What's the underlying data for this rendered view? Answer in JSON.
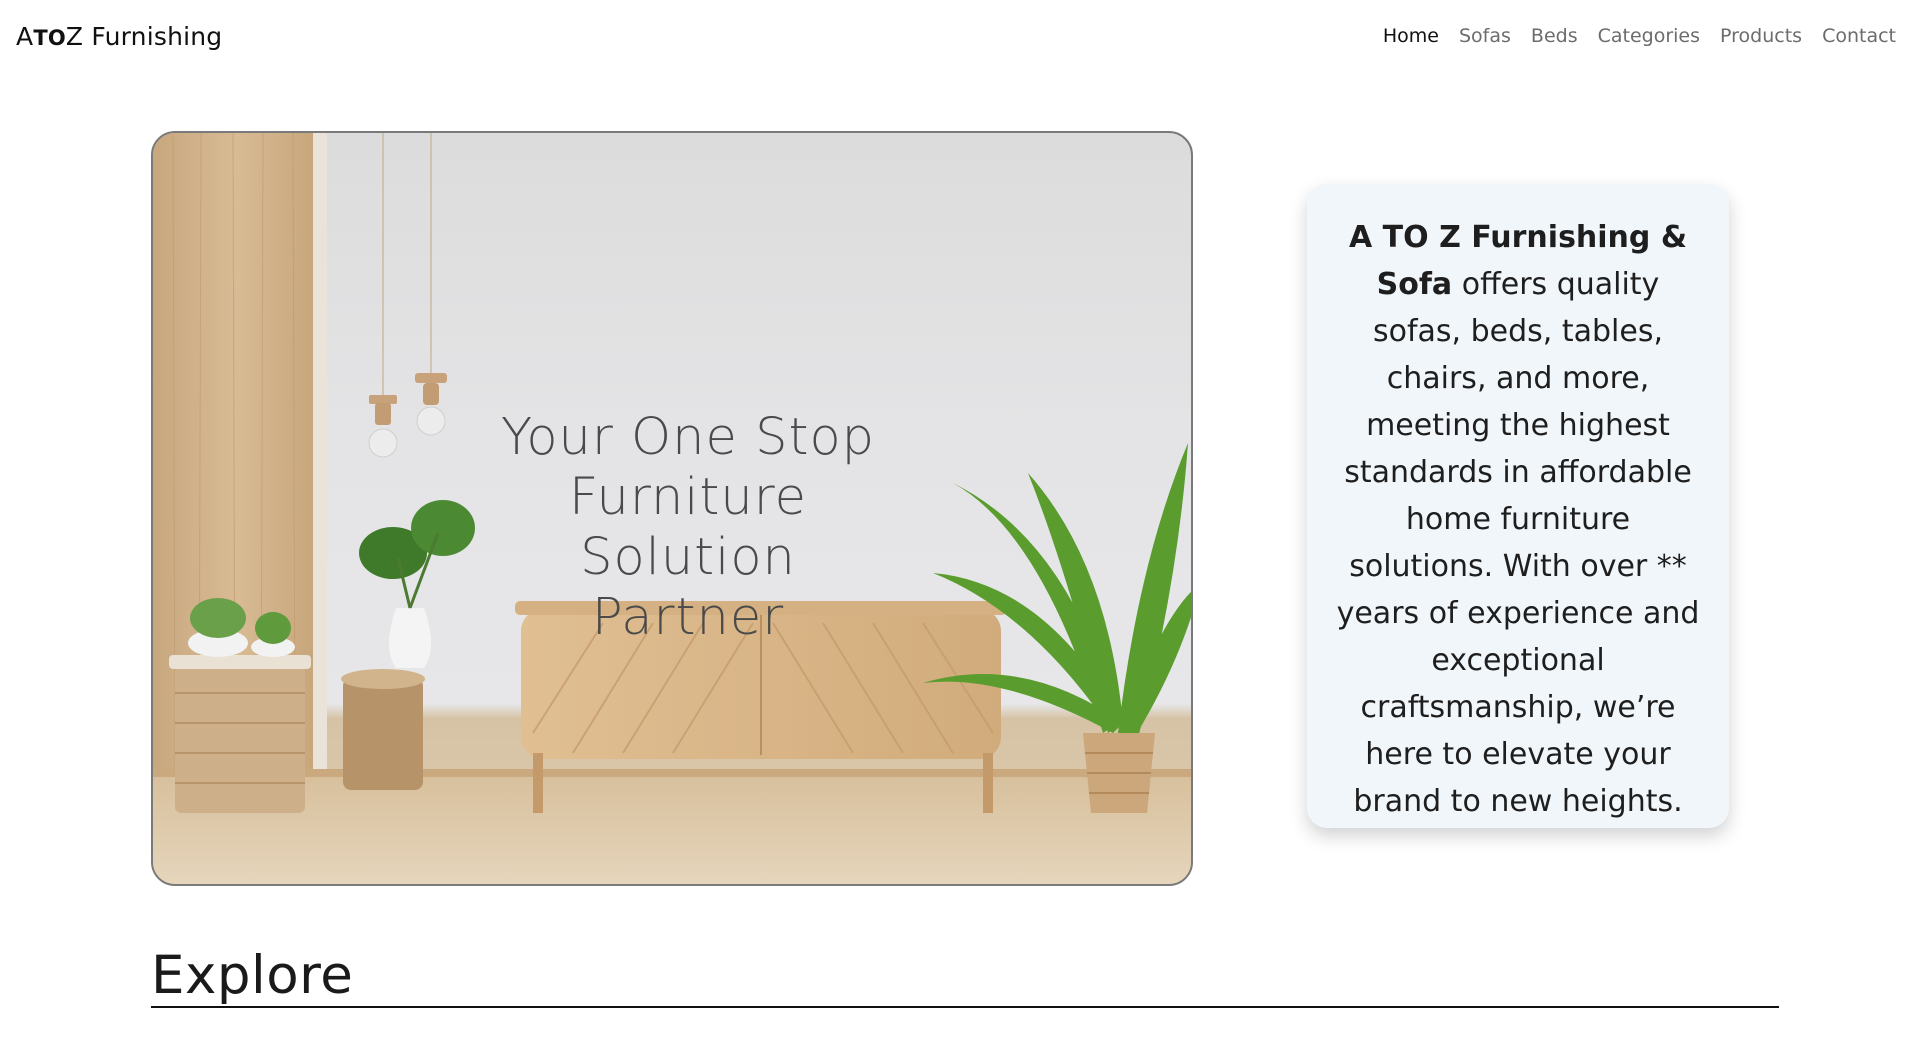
{
  "navbar": {
    "brand": {
      "part1": "A",
      "part2": "TO",
      "part3": "Z Furnishing"
    },
    "links": [
      "Home",
      "Sofas",
      "Beds",
      "Categories",
      "Products",
      "Contact"
    ],
    "active": "Home"
  },
  "hero": {
    "title": "Your One Stop\nFurniture Solution\nPartner"
  },
  "info_card": {
    "bold_text": "A TO Z Furnishing & Sofa",
    "text": " offers quality sofas, beds, tables, chairs, and more, meeting the highest standards in affordable home furniture solutions. With over ** years of experience and exceptional craftsmanship, we’re here to elevate your brand to new heights."
  },
  "explore": {
    "title": "Explore"
  },
  "colors": {
    "card_bg": "#f1f6fa",
    "nav_active": "#111111",
    "nav_inactive": "#6c6c6c"
  }
}
